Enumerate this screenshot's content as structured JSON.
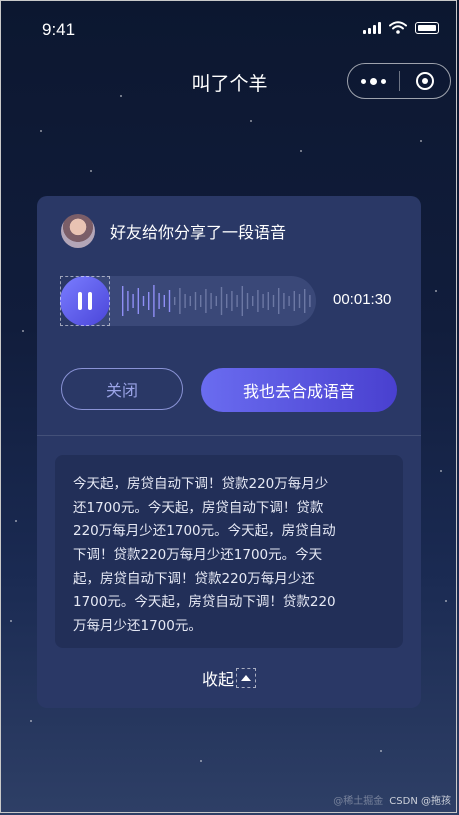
{
  "status_bar": {
    "time": "9:41"
  },
  "nav": {
    "title": "叫了个羊"
  },
  "card": {
    "share_text": "好友给你分享了一段语音",
    "duration": "00:01:30",
    "close_label": "关闭",
    "synth_label": "我也去合成语音",
    "body_lines": [
      "今天起，房贷自动下调！贷款220万每月少",
      "还1700元。今天起，房贷自动下调！贷款",
      "220万每月少还1700元。今天起，房贷自动",
      "下调！贷款220万每月少还1700元。今天",
      "起，房贷自动下调！贷款220万每月少还",
      "1700元。今天起，房贷自动下调！贷款220",
      "万每月少还1700元。"
    ],
    "collapse_label": "收起"
  },
  "watermark": {
    "faint": "@稀土掘金",
    "main": "CSDN @拖孩"
  },
  "colors": {
    "accent": "#5a58e6",
    "card_bg": "#2a3866",
    "text_box_bg": "#222f58",
    "page_top": "#0c1730"
  },
  "icons": [
    "signal-icon",
    "wifi-icon",
    "battery-icon",
    "more-icon",
    "target-icon",
    "pause-icon",
    "caret-up-icon"
  ]
}
